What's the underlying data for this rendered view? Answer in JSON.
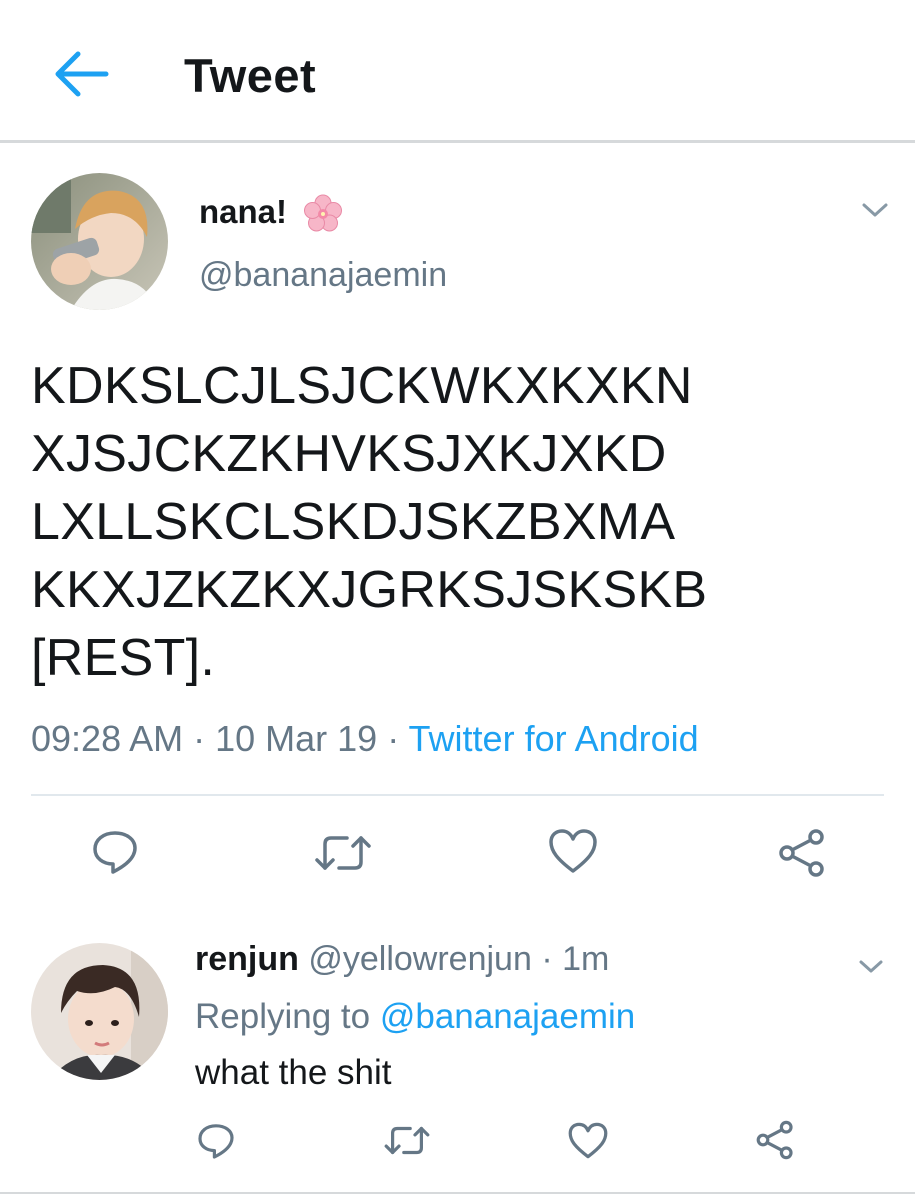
{
  "header": {
    "title": "Tweet",
    "back_icon": "arrow-left-icon",
    "accent": "#1da1f2"
  },
  "tweet": {
    "display_name": "nana!",
    "name_emoji": "cherry-blossom-icon",
    "handle": "@bananajaemin",
    "text": "KDKSLCJLSJCKWKXKXKN\nXJSJCKZKHVKSJXKJXKD\nLXLLSKCLSKDJSKZBXMA\nKKXJZKZKXJGRKSJSKSKB\n[REST].",
    "time": "09:28 AM",
    "separator": " · ",
    "date": "10 Mar 19",
    "source": "Twitter for Android",
    "actions": [
      "reply-icon",
      "retweet-icon",
      "like-icon",
      "share-icon"
    ]
  },
  "reply": {
    "display_name": "renjun",
    "handle": "@yellowrenjun",
    "separator": " · ",
    "time": "1m",
    "replying_to_label": "Replying to ",
    "replying_to_handle": "@bananajaemin",
    "text": "what the shit",
    "actions": [
      "reply-icon",
      "retweet-icon",
      "like-icon",
      "share-icon"
    ]
  },
  "colors": {
    "text": "#14171a",
    "secondary": "#657786",
    "link": "#1da1f2",
    "divider": "#e1e8ed"
  }
}
